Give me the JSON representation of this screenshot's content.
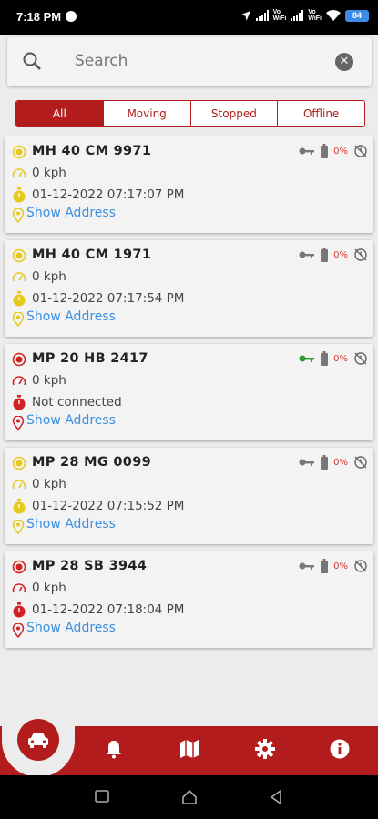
{
  "status_bar": {
    "time": "7:18 PM",
    "battery": "84",
    "vo_label": "Vo",
    "wifi_label": "WiFi"
  },
  "search": {
    "placeholder": "Search"
  },
  "filters": [
    {
      "label": "All",
      "active": true
    },
    {
      "label": "Moving",
      "active": false
    },
    {
      "label": "Stopped",
      "active": false
    },
    {
      "label": "Offline",
      "active": false
    }
  ],
  "vehicles": [
    {
      "reg": "MH 40 CM  9971",
      "speed": "0 kph",
      "time": "01-12-2022 07:17:07 PM",
      "address_link": "Show Address",
      "status": "stopped",
      "battery_pct": "0%",
      "ignition": "off"
    },
    {
      "reg": "MH 40 CM 1971",
      "speed": "0 kph",
      "time": "01-12-2022 07:17:54 PM",
      "address_link": "Show Address",
      "status": "stopped",
      "battery_pct": "0%",
      "ignition": "off"
    },
    {
      "reg": "MP 20 HB 2417",
      "speed": "0 kph",
      "time": "Not connected",
      "address_link": "Show Address",
      "status": "offline",
      "battery_pct": "0%",
      "ignition": "on"
    },
    {
      "reg": "MP 28 MG 0099",
      "speed": "0 kph",
      "time": "01-12-2022 07:15:52 PM",
      "address_link": "Show Address",
      "status": "stopped",
      "battery_pct": "0%",
      "ignition": "off"
    },
    {
      "reg": "MP 28 SB 3944",
      "speed": "0 kph",
      "time": "01-12-2022 07:18:04 PM",
      "address_link": "Show Address",
      "status": "offline",
      "battery_pct": "0%",
      "ignition": "off"
    }
  ],
  "bottom_nav": {
    "items": [
      "car-icon",
      "bell-icon",
      "map-icon",
      "gear-icon",
      "info-icon"
    ]
  },
  "colors": {
    "brand": "#b31c1c",
    "stopped": "#e8c81a",
    "offline": "#d32020",
    "link": "#3d8fe0",
    "ignition_on": "#2e9a2e"
  }
}
